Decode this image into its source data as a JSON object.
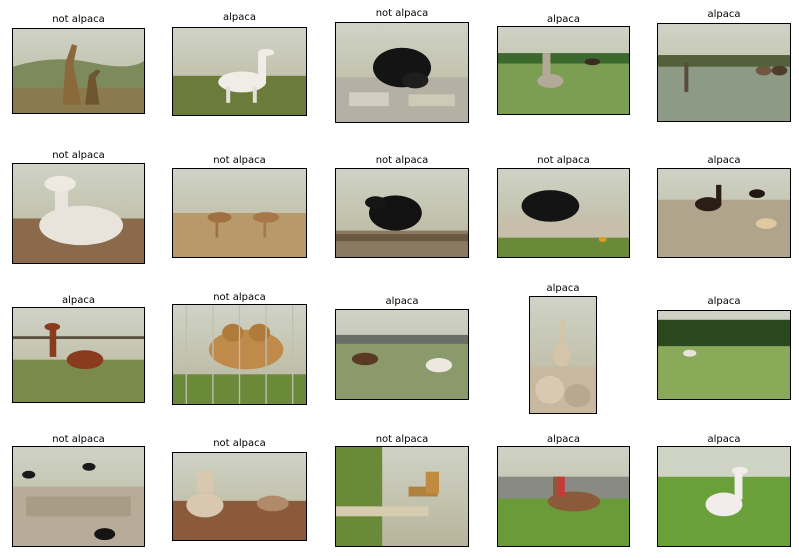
{
  "grid": {
    "rows": 4,
    "columns": 5,
    "cells": [
      {
        "label": "not alpaca",
        "scene": "giraffes-on-savanna-hills"
      },
      {
        "label": "alpaca",
        "scene": "white-alpaca-on-grass"
      },
      {
        "label": "not alpaca",
        "scene": "black-bear-on-rocks"
      },
      {
        "label": "alpaca",
        "scene": "alpacas-in-park"
      },
      {
        "label": "alpaca",
        "scene": "llamas-in-frosty-field"
      },
      {
        "label": "not alpaca",
        "scene": "white-camel-lying-down"
      },
      {
        "label": "not alpaca",
        "scene": "camels-in-desert"
      },
      {
        "label": "not alpaca",
        "scene": "black-bear-on-logs"
      },
      {
        "label": "not alpaca",
        "scene": "bear-on-log-with-flowers"
      },
      {
        "label": "alpaca",
        "scene": "llamas-with-dog"
      },
      {
        "label": "alpaca",
        "scene": "brown-llama-in-field"
      },
      {
        "label": "not alpaca",
        "scene": "bactrian-camel-behind-fence"
      },
      {
        "label": "alpaca",
        "scene": "two-alpacas-grazing"
      },
      {
        "label": "alpaca",
        "scene": "alpaca-on-rocks"
      },
      {
        "label": "alpaca",
        "scene": "alpaca-in-green-meadow"
      },
      {
        "label": "not alpaca",
        "scene": "bears-in-zoo-enclosure"
      },
      {
        "label": "not alpaca",
        "scene": "camels-at-sunset"
      },
      {
        "label": "not alpaca",
        "scene": "giraffe-rotated-photo"
      },
      {
        "label": "alpaca",
        "scene": "person-with-llama-near-stone-wall"
      },
      {
        "label": "alpaca",
        "scene": "white-alpaca-on-grass-field"
      }
    ]
  },
  "colors": {
    "frame": "#000000",
    "background": "#ffffff"
  }
}
